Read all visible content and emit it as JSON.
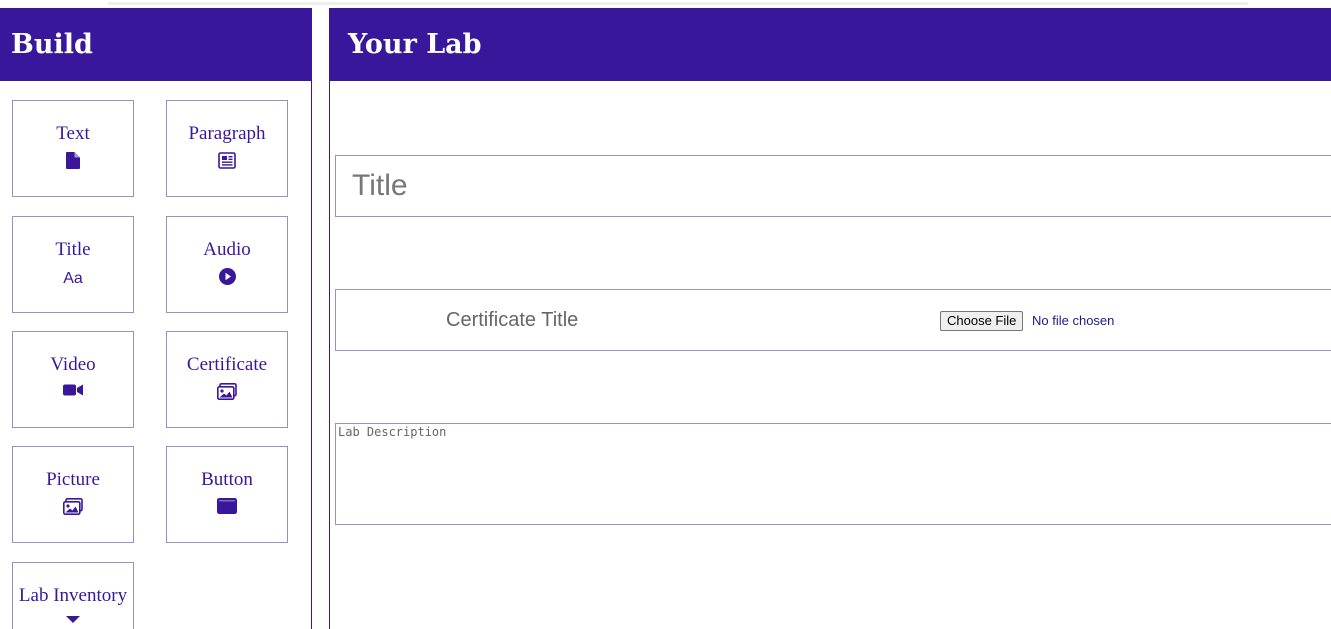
{
  "sidebar": {
    "title": "Build",
    "tools": [
      {
        "label": "Text",
        "icon": "file-icon"
      },
      {
        "label": "Paragraph",
        "icon": "newspaper-icon"
      },
      {
        "label": "Title",
        "icon": "font-case-icon",
        "glyph": "Aa"
      },
      {
        "label": "Audio",
        "icon": "play-circle-icon"
      },
      {
        "label": "Video",
        "icon": "video-camera-icon"
      },
      {
        "label": "Certificate",
        "icon": "images-icon"
      },
      {
        "label": "Picture",
        "icon": "images-icon"
      },
      {
        "label": "Button",
        "icon": "button-rectangle-icon"
      },
      {
        "label": "Lab Inventory",
        "icon": "caret-down-icon"
      }
    ]
  },
  "main": {
    "title": "Your Lab",
    "title_input": {
      "placeholder": "Title",
      "value": ""
    },
    "certificate": {
      "placeholder": "Certificate Title",
      "file_button": "Choose File",
      "file_status": "No file chosen"
    },
    "description": {
      "placeholder": "Lab Description",
      "value": ""
    }
  },
  "colors": {
    "brand": "#38179b",
    "border": "#9a8fc4",
    "header_text": "#ffffff"
  }
}
